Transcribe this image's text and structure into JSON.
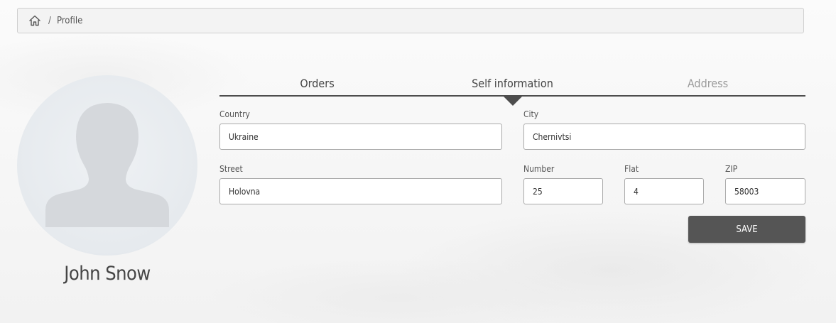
{
  "breadcrumb": {
    "home_icon": "home-icon",
    "separator": "/",
    "current": "Profile"
  },
  "profile": {
    "avatar_icon": "user-silhouette-icon",
    "name": "John Snow"
  },
  "tabs": [
    {
      "label": "Orders",
      "active": false
    },
    {
      "label": "Self information",
      "active": true
    },
    {
      "label": "Address",
      "active": false
    }
  ],
  "address_form": {
    "country": {
      "label": "Country",
      "value": "Ukraine"
    },
    "city": {
      "label": "City",
      "value": "Chernivtsi"
    },
    "street": {
      "label": "Street",
      "value": "Holovna"
    },
    "number": {
      "label": "Number",
      "value": "25"
    },
    "flat": {
      "label": "Flat",
      "value": "4"
    },
    "zip": {
      "label": "ZIP",
      "value": "58003"
    },
    "save_label": "SAVE"
  },
  "colors": {
    "accent_dark": "#555555",
    "tab_underline": "#4d4d4d",
    "inactive_tab_text": "#9a9a9a"
  }
}
